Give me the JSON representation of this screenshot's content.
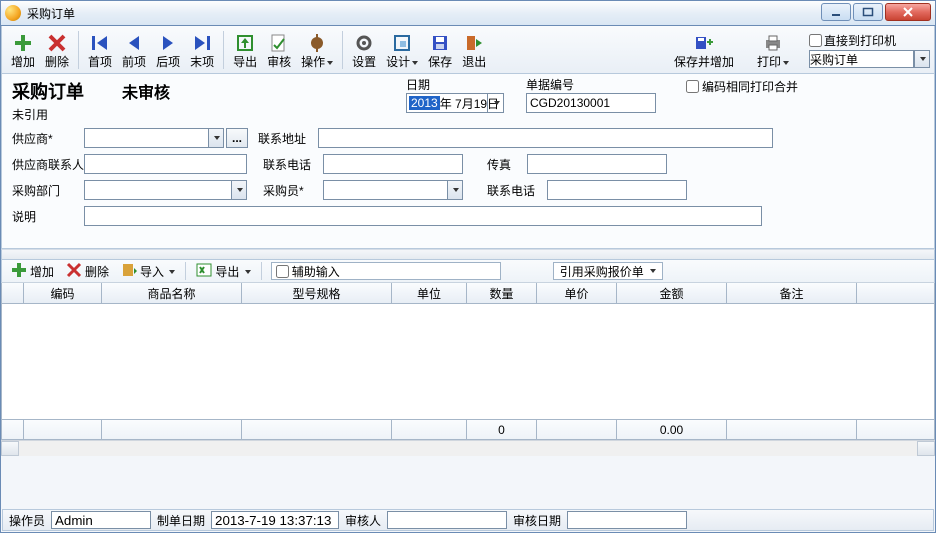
{
  "window": {
    "title": "采购订单"
  },
  "toolbar": {
    "add": "增加",
    "del": "删除",
    "first": "首项",
    "prev": "前项",
    "next": "后项",
    "last": "末项",
    "export": "导出",
    "audit": "审核",
    "ops": "操作",
    "settings": "设置",
    "design": "设计",
    "save": "保存",
    "exit": "退出",
    "save_and_add": "保存并增加",
    "print": "打印",
    "direct_to_printer": "直接到打印机",
    "print_template": "采购订单"
  },
  "header": {
    "doc_title": "采购订单",
    "status": "未审核",
    "not_referenced": "未引用",
    "date_label": "日期",
    "date_year": "2013",
    "date_rest": "年 7月19日",
    "docno_label": "单据编号",
    "docno": "CGD20130001",
    "merge_print": "编码相同打印合并"
  },
  "form": {
    "supplier_lbl": "供应商*",
    "addr_lbl": "联系地址",
    "contact_lbl": "供应商联系人",
    "tel_lbl": "联系电话",
    "fax_lbl": "传真",
    "dept_lbl": "采购部门",
    "buyer_lbl": "采购员*",
    "tel2_lbl": "联系电话",
    "desc_lbl": "说明",
    "ellipsis": "..."
  },
  "gridtoolbar": {
    "add": "增加",
    "del": "删除",
    "import": "导入",
    "export": "导出",
    "aux_input": "辅助输入",
    "quote_ref": "引用采购报价单"
  },
  "grid": {
    "columns": [
      "编码",
      "商品名称",
      "型号规格",
      "单位",
      "数量",
      "单价",
      "金额",
      "备注"
    ],
    "sum_qty": "0",
    "sum_amount": "0.00"
  },
  "status": {
    "operator_lbl": "操作员",
    "operator": "Admin",
    "created_lbl": "制单日期",
    "created": "2013-7-19 13:37:13",
    "auditor_lbl": "审核人",
    "auditor": "",
    "audit_date_lbl": "审核日期",
    "audit_date": ""
  }
}
